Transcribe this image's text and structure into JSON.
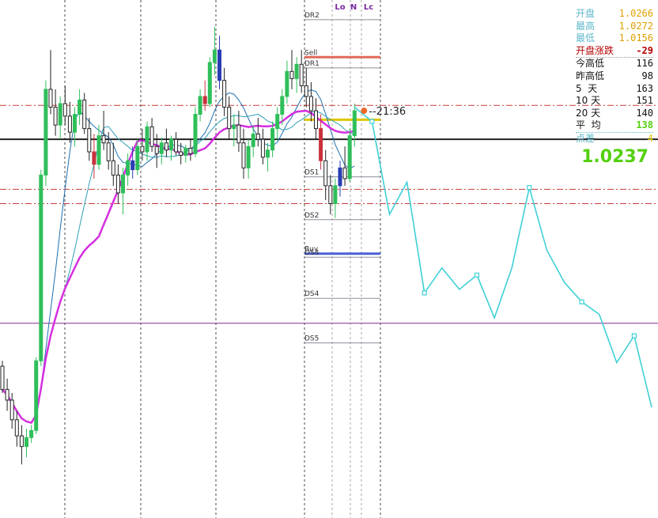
{
  "colors": {
    "bg": "#ffffff",
    "bull": "#2fbf5a",
    "bear": "#222222",
    "mark_red": "#c8323c",
    "mark_blue": "#2a3db3",
    "ma_slow": "#d62ee0",
    "ma_mid": "#2e9fb5",
    "ma_fast": "#1c6fb0",
    "projection": "#3fd0d6",
    "hline_red": "#c93a3a",
    "level_gold": "#e0c400",
    "level_red": "#e06a5a",
    "level_blue": "#4a5fd6",
    "level_grey": "#8a8f99",
    "purple_line": "#8a2a8a",
    "current_dot": "#ee6a2a",
    "info_orange": "#e0a000",
    "info_teal": "#5fb7c9",
    "info_darkred": "#b30000",
    "info_green": "#55d010",
    "info_black": "#111111"
  },
  "chart_data": {
    "type": "candlestick",
    "title": "",
    "xlabel": "",
    "ylabel": "",
    "price_scale_note": "",
    "candles": [
      {
        "o": 1.0085,
        "h": 1.0088,
        "l": 1.007,
        "c": 1.0072
      },
      {
        "o": 1.0072,
        "h": 1.0078,
        "l": 1.006,
        "c": 1.0066
      },
      {
        "o": 1.0066,
        "h": 1.007,
        "l": 1.005,
        "c": 1.0055
      },
      {
        "o": 1.0055,
        "h": 1.006,
        "l": 1.004,
        "c": 1.0046
      },
      {
        "o": 1.0046,
        "h": 1.0052,
        "l": 1.003,
        "c": 1.004
      },
      {
        "o": 1.004,
        "h": 1.005,
        "l": 1.0034,
        "c": 1.0045
      },
      {
        "o": 1.0045,
        "h": 1.0052,
        "l": 1.0042,
        "c": 1.0049
      },
      {
        "o": 1.0049,
        "h": 1.009,
        "l": 1.0047,
        "c": 1.0088
      },
      {
        "o": 1.0088,
        "h": 1.0195,
        "l": 1.0085,
        "c": 1.0192
      },
      {
        "o": 1.0192,
        "h": 1.0245,
        "l": 1.0186,
        "c": 1.024
      },
      {
        "o": 1.024,
        "h": 1.0262,
        "l": 1.0226,
        "c": 1.023
      },
      {
        "o": 1.023,
        "h": 1.024,
        "l": 1.0214,
        "c": 1.022
      },
      {
        "o": 1.022,
        "h": 1.0236,
        "l": 1.0212,
        "c": 1.0232
      },
      {
        "o": 1.0232,
        "h": 1.0242,
        "l": 1.022,
        "c": 1.0225
      },
      {
        "o": 1.0225,
        "h": 1.0233,
        "l": 1.021,
        "c": 1.0216
      },
      {
        "o": 1.0216,
        "h": 1.023,
        "l": 1.0208,
        "c": 1.0226
      },
      {
        "o": 1.0226,
        "h": 1.024,
        "l": 1.022,
        "c": 1.0234
      },
      {
        "o": 1.0234,
        "h": 1.0238,
        "l": 1.0215,
        "c": 1.0218
      },
      {
        "o": 1.0218,
        "h": 1.0224,
        "l": 1.02,
        "c": 1.0205
      },
      {
        "o": 1.0205,
        "h": 1.0215,
        "l": 1.019,
        "c": 1.0198
      },
      {
        "o": 1.0198,
        "h": 1.022,
        "l": 1.0195,
        "c": 1.0214
      },
      {
        "o": 1.0214,
        "h": 1.0228,
        "l": 1.0206,
        "c": 1.021
      },
      {
        "o": 1.021,
        "h": 1.0216,
        "l": 1.0195,
        "c": 1.02
      },
      {
        "o": 1.02,
        "h": 1.021,
        "l": 1.0186,
        "c": 1.0192
      },
      {
        "o": 1.0192,
        "h": 1.0198,
        "l": 1.0176,
        "c": 1.0182
      },
      {
        "o": 1.0182,
        "h": 1.0196,
        "l": 1.017,
        "c": 1.0192
      },
      {
        "o": 1.0192,
        "h": 1.0204,
        "l": 1.0186,
        "c": 1.02
      },
      {
        "o": 1.02,
        "h": 1.0208,
        "l": 1.019,
        "c": 1.0195
      },
      {
        "o": 1.0195,
        "h": 1.0212,
        "l": 1.0192,
        "c": 1.0208
      },
      {
        "o": 1.0208,
        "h": 1.0218,
        "l": 1.02,
        "c": 1.0205
      },
      {
        "o": 1.0205,
        "h": 1.0222,
        "l": 1.02,
        "c": 1.0219
      },
      {
        "o": 1.0219,
        "h": 1.0224,
        "l": 1.0205,
        "c": 1.0208
      },
      {
        "o": 1.0208,
        "h": 1.0215,
        "l": 1.0196,
        "c": 1.0204
      },
      {
        "o": 1.0204,
        "h": 1.0213,
        "l": 1.0198,
        "c": 1.021
      },
      {
        "o": 1.021,
        "h": 1.0218,
        "l": 1.0202,
        "c": 1.0206
      },
      {
        "o": 1.0206,
        "h": 1.0214,
        "l": 1.02,
        "c": 1.0212
      },
      {
        "o": 1.0212,
        "h": 1.0216,
        "l": 1.0203,
        "c": 1.0205
      },
      {
        "o": 1.0205,
        "h": 1.021,
        "l": 1.0198,
        "c": 1.0203
      },
      {
        "o": 1.0203,
        "h": 1.0209,
        "l": 1.0199,
        "c": 1.0207
      },
      {
        "o": 1.0207,
        "h": 1.0212,
        "l": 1.02,
        "c": 1.0204
      },
      {
        "o": 1.0204,
        "h": 1.023,
        "l": 1.0202,
        "c": 1.0226
      },
      {
        "o": 1.0226,
        "h": 1.024,
        "l": 1.0222,
        "c": 1.0236
      },
      {
        "o": 1.0236,
        "h": 1.0245,
        "l": 1.0228,
        "c": 1.0232
      },
      {
        "o": 1.0232,
        "h": 1.0258,
        "l": 1.023,
        "c": 1.0255
      },
      {
        "o": 1.0255,
        "h": 1.0275,
        "l": 1.0248,
        "c": 1.0262
      },
      {
        "o": 1.0262,
        "h": 1.027,
        "l": 1.024,
        "c": 1.0245
      },
      {
        "o": 1.0245,
        "h": 1.0252,
        "l": 1.0225,
        "c": 1.023
      },
      {
        "o": 1.023,
        "h": 1.0236,
        "l": 1.0212,
        "c": 1.0218
      },
      {
        "o": 1.0218,
        "h": 1.0226,
        "l": 1.0208,
        "c": 1.022
      },
      {
        "o": 1.022,
        "h": 1.0228,
        "l": 1.0205,
        "c": 1.021
      },
      {
        "o": 1.021,
        "h": 1.0218,
        "l": 1.019,
        "c": 1.0196
      },
      {
        "o": 1.0196,
        "h": 1.0212,
        "l": 1.019,
        "c": 1.0208
      },
      {
        "o": 1.0208,
        "h": 1.022,
        "l": 1.0202,
        "c": 1.0215
      },
      {
        "o": 1.0215,
        "h": 1.0224,
        "l": 1.0208,
        "c": 1.0212
      },
      {
        "o": 1.0212,
        "h": 1.0218,
        "l": 1.0198,
        "c": 1.0202
      },
      {
        "o": 1.0202,
        "h": 1.021,
        "l": 1.0194,
        "c": 1.0206
      },
      {
        "o": 1.0206,
        "h": 1.0222,
        "l": 1.0202,
        "c": 1.0218
      },
      {
        "o": 1.0218,
        "h": 1.023,
        "l": 1.0212,
        "c": 1.0226
      },
      {
        "o": 1.0226,
        "h": 1.024,
        "l": 1.022,
        "c": 1.0236
      },
      {
        "o": 1.0236,
        "h": 1.0256,
        "l": 1.0232,
        "c": 1.025
      },
      {
        "o": 1.025,
        "h": 1.0262,
        "l": 1.024,
        "c": 1.0246
      },
      {
        "o": 1.0246,
        "h": 1.0258,
        "l": 1.0238,
        "c": 1.0254
      },
      {
        "o": 1.0254,
        "h": 1.0262,
        "l": 1.0238,
        "c": 1.0242
      },
      {
        "o": 1.0242,
        "h": 1.0252,
        "l": 1.023,
        "c": 1.0236
      },
      {
        "o": 1.0236,
        "h": 1.0244,
        "l": 1.0222,
        "c": 1.0228
      },
      {
        "o": 1.0228,
        "h": 1.0235,
        "l": 1.0212,
        "c": 1.0218
      },
      {
        "o": 1.0218,
        "h": 1.0226,
        "l": 1.0195,
        "c": 1.02
      },
      {
        "o": 1.02,
        "h": 1.0206,
        "l": 1.0178,
        "c": 1.0186
      },
      {
        "o": 1.0186,
        "h": 1.0192,
        "l": 1.017,
        "c": 1.0176
      },
      {
        "o": 1.0176,
        "h": 1.019,
        "l": 1.0168,
        "c": 1.0186
      },
      {
        "o": 1.0186,
        "h": 1.02,
        "l": 1.018,
        "c": 1.0196
      },
      {
        "o": 1.0196,
        "h": 1.0208,
        "l": 1.0186,
        "c": 1.019
      },
      {
        "o": 1.019,
        "h": 1.0218,
        "l": 1.0188,
        "c": 1.0214
      },
      {
        "o": 1.0214,
        "h": 1.0232,
        "l": 1.0208,
        "c": 1.0228
      }
    ],
    "moving_averages": [
      {
        "period": 8,
        "color_key": "ma_fast"
      },
      {
        "period": 14,
        "color_key": "ma_mid"
      },
      {
        "period": 21,
        "color_key": "ma_slow"
      }
    ],
    "marked_candles": [
      {
        "index": 19,
        "color_key": "mark_red"
      },
      {
        "index": 27,
        "color_key": "mark_blue"
      },
      {
        "index": 42,
        "color_key": "mark_red"
      },
      {
        "index": 45,
        "color_key": "mark_blue"
      },
      {
        "index": 66,
        "color_key": "mark_red"
      },
      {
        "index": 70,
        "color_key": "mark_blue"
      }
    ],
    "projection": [
      1.023,
      1.0222,
      1.017,
      1.0188,
      1.0126,
      1.014,
      1.0128,
      1.0136,
      1.0112,
      1.014,
      1.0185,
      1.015,
      1.0132,
      1.0121,
      1.0114,
      1.0087,
      1.0102,
      1.0062
    ],
    "horizontal_lines": [
      {
        "value": 1.0212,
        "style": "solid",
        "color_key": "bear",
        "width": 2
      },
      {
        "value": 1.0231,
        "style": "dashdot",
        "color_key": "hline_red",
        "width": 1
      },
      {
        "value": 1.0184,
        "style": "dashdot",
        "color_key": "hline_red",
        "width": 1
      },
      {
        "value": 1.0176,
        "style": "dashdot",
        "color_key": "hline_red",
        "width": 1
      },
      {
        "value": 1.0109,
        "style": "solid",
        "color_key": "purple_line",
        "width": 1
      }
    ],
    "levels": [
      {
        "label": "DR2",
        "value": 1.0279,
        "color_key": "level_grey"
      },
      {
        "label": "Sell",
        "value": 1.0258,
        "color_key": "level_red"
      },
      {
        "label": "DR1",
        "value": 1.0252,
        "color_key": "level_grey"
      },
      {
        "label": "",
        "value": 1.0223,
        "color_key": "level_gold"
      },
      {
        "label": "DS1",
        "value": 1.0191,
        "color_key": "level_grey"
      },
      {
        "label": "DS2",
        "value": 1.0167,
        "color_key": "level_grey"
      },
      {
        "label": "Buy",
        "value": 1.0148,
        "color_key": "level_blue"
      },
      {
        "label": "DS3",
        "value": 1.0146,
        "color_key": "level_grey"
      },
      {
        "label": "DS4",
        "value": 1.0123,
        "color_key": "level_grey"
      },
      {
        "label": "DS5",
        "value": 1.0098,
        "color_key": "level_grey"
      }
    ],
    "session_markers": [
      "Lo",
      "N",
      "Lc"
    ],
    "countdown": "21:36",
    "y_range": [
      1.0,
      1.029
    ]
  },
  "info_panel": {
    "open_label": "开盘",
    "open_value": "1.0266",
    "high_label": "最高",
    "high_value": "1.0272",
    "low_label": "最低",
    "low_value": "1.0156",
    "change_label": "开盘涨跌",
    "change_value": "-29",
    "rows": [
      {
        "label": "今高低",
        "value": "116"
      },
      {
        "label": "昨高低",
        "value": "98"
      },
      {
        "label": "5  天",
        "value": "163"
      },
      {
        "label": "10 天",
        "value": "151"
      },
      {
        "label": "20 天",
        "value": "140"
      }
    ],
    "avg_label": "平  均",
    "avg_value": "138",
    "spread_label": "点差",
    "spread_value": "4",
    "current_price": "1.0237"
  }
}
